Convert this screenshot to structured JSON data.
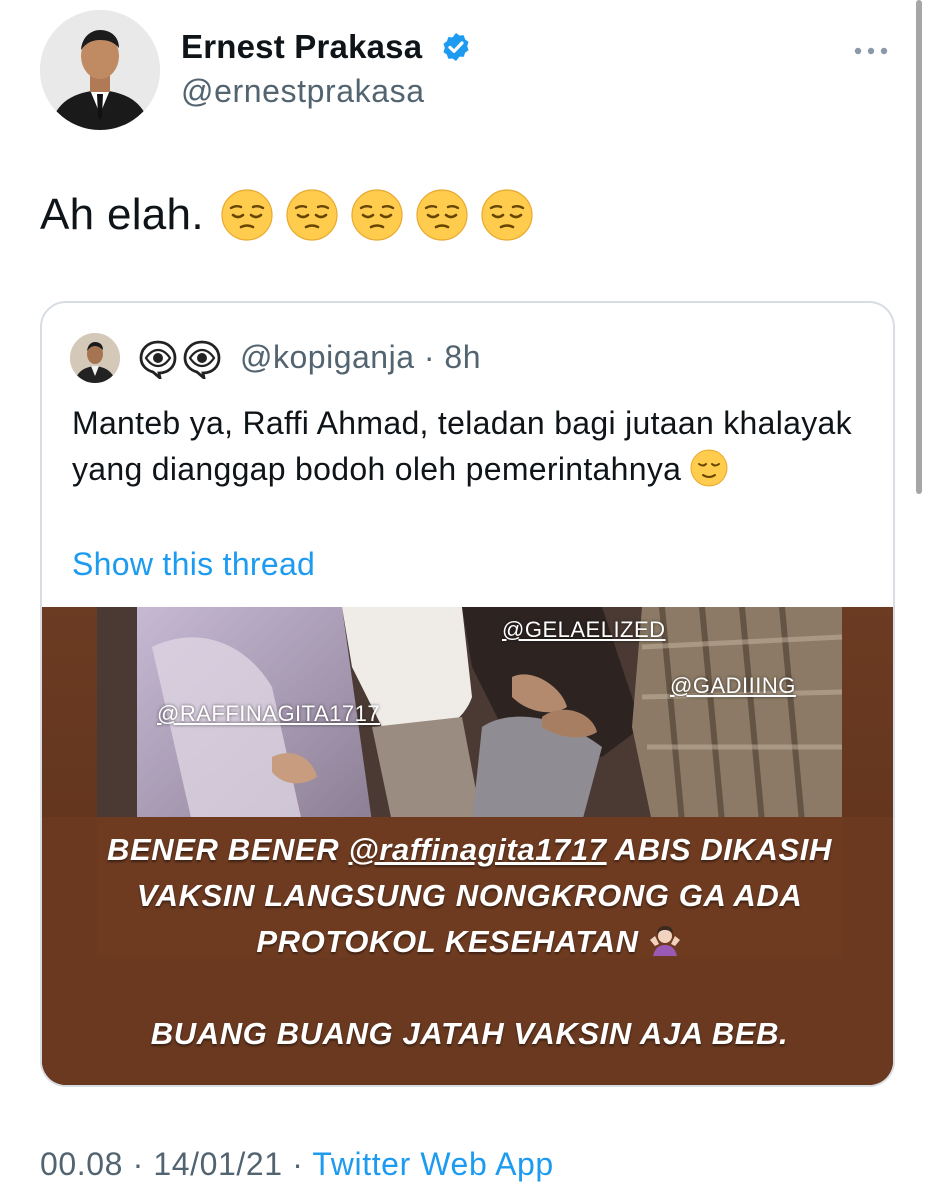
{
  "author": {
    "name": "Ernest Prakasa",
    "handle": "@ernestprakasa",
    "verified": true,
    "avatar": "man-in-black-suit-photo"
  },
  "tweet": {
    "text": "Ah elah.",
    "emojis": [
      "pensive-face",
      "pensive-face",
      "pensive-face",
      "pensive-face",
      "pensive-face"
    ]
  },
  "quoted_tweet": {
    "avatar": "man-in-suit-photo",
    "name_emojis": [
      "eye-in-speech-bubble",
      "eye-in-speech-bubble"
    ],
    "handle": "@kopiganja",
    "separator": "·",
    "time": "8h",
    "text": "Manteb ya, Raffi Ahmad, teladan bagi jutaan khalayak yang dianggap bodoh oleh pemerintahnya",
    "text_emoji": "relieved-face",
    "show_thread_label": "Show this thread",
    "media": {
      "tags": {
        "raffi": "@RAFFINAGITA1717",
        "gelael": "@GELAELIZED",
        "gadiing": "@GADIIING"
      },
      "caption_line1_a": "BENER BENER ",
      "caption_line1_mention": "@raffinagita1717",
      "caption_line1_b": " ABIS DIKASIH",
      "caption_line2": "VAKSIN LANGSUNG NONGKRONG GA ADA",
      "caption_line3": "PROTOKOL KESEHATAN",
      "caption_line3_emoji": "person-shrugging",
      "caption_line4": "BUANG BUANG JATAH VAKSIN AJA BEB."
    }
  },
  "footer": {
    "time": "00.08",
    "date": "14/01/21",
    "separator": "·",
    "source": "Twitter Web App"
  },
  "colors": {
    "link_blue": "#1d9bf0",
    "secondary_text": "#536471",
    "verified_blue": "#1d9bf0",
    "media_background": "#6d3b22"
  }
}
